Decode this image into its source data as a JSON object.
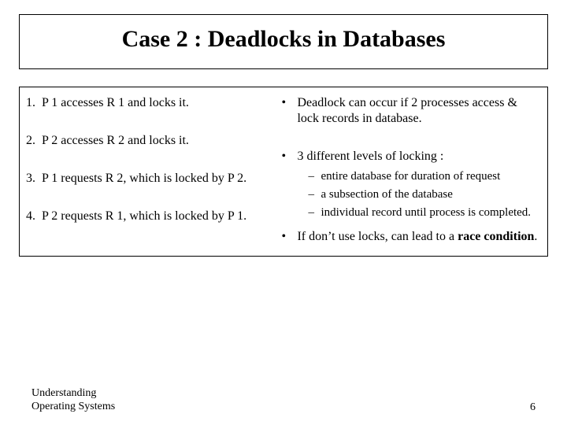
{
  "title": "Case 2 : Deadlocks in Databases",
  "left": {
    "items": [
      {
        "n": "1.",
        "t": "P 1 accesses R 1 and locks it."
      },
      {
        "n": "2.",
        "t": "P 2 accesses R 2 and locks it."
      },
      {
        "n": "3.",
        "t": "P 1 requests R 2, which is locked by P 2."
      },
      {
        "n": "4.",
        "t": "P 2 requests R 1, which is locked by P 1."
      }
    ]
  },
  "right": {
    "b1": "Deadlock can occur if 2 processes access & lock records in database.",
    "b2": "3 different levels of locking :",
    "subs": [
      "entire database for duration of request",
      "a subsection of the database",
      "individual record until process is completed."
    ],
    "b3_pre": "If don’t use locks, can lead to a ",
    "b3_bold": "race condition",
    "b3_post": "."
  },
  "footer": {
    "left1": "Understanding",
    "left2": "Operating Systems",
    "page": "6"
  }
}
